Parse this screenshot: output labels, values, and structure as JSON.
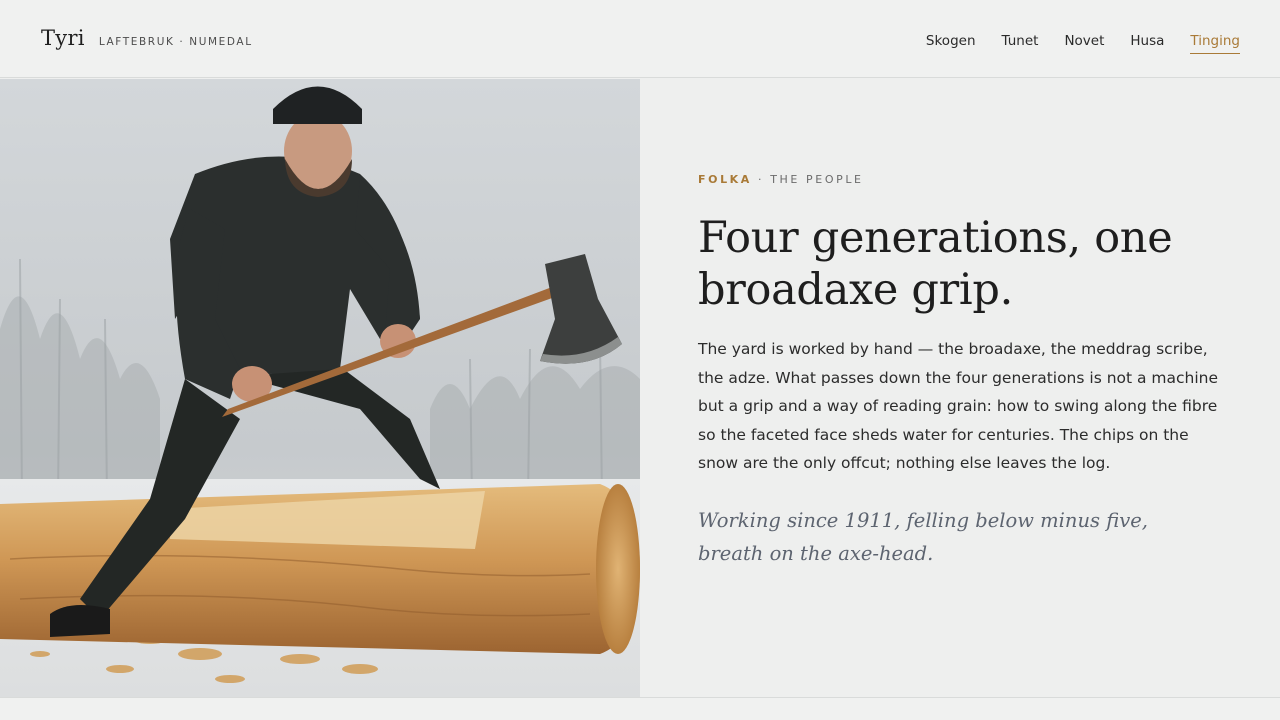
{
  "header": {
    "brand_name": "Tyri",
    "brand_sub": "LAFTEBRUK · NUMEDAL",
    "nav": [
      {
        "label": "Skogen"
      },
      {
        "label": "Tunet"
      },
      {
        "label": "Novet"
      },
      {
        "label": "Husa"
      },
      {
        "label": "Tinging",
        "active": true
      }
    ]
  },
  "section": {
    "eyebrow_accent": "FOLKA",
    "eyebrow_sep": " · ",
    "eyebrow_rest": "THE PEOPLE",
    "headline": "Four generations, one broadaxe grip.",
    "body": "The yard is worked by hand — the broadaxe, the meddrag scribe, the adze. What passes down the four generations is not a machine but a grip and a way of reading grain: how to swing along the fibre so the faceted face sheds water for centuries. The chips on the snow are the only offcut; nothing else leaves the log.",
    "quote": "Working since 1911, felling below minus five, breath on the axe-head."
  },
  "colors": {
    "accent": "#a97a37",
    "background": "#eeefee",
    "quote": "#5d6470"
  },
  "photo": {
    "icon": "man-hewing-log-with-broadaxe-photo"
  }
}
